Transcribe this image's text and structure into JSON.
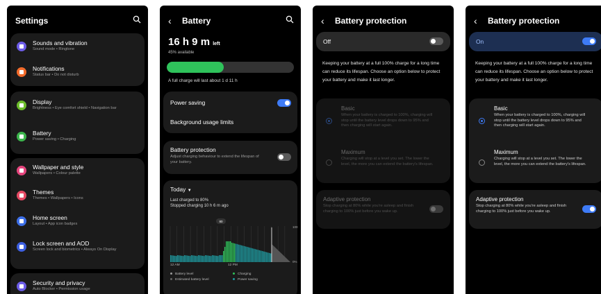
{
  "colors": {
    "accent": "#3e7bf6",
    "battery_green": "#2fc35b",
    "teal": "#1e9aa0",
    "bg": "#000000",
    "card": "#1b1b1b"
  },
  "settings": {
    "title": "Settings",
    "items": [
      {
        "label": "Sounds and vibration",
        "sub": "Sound mode  •  Ringtone",
        "icon": "sound-icon",
        "color": "#6d5ce8"
      },
      {
        "label": "Notifications",
        "sub": "Status bar  •  Do not disturb",
        "icon": "bell-icon",
        "color": "#f26b2b"
      },
      {
        "label": "Display",
        "sub": "Brightness  •  Eye comfort shield  •  Navigation bar",
        "icon": "sun-icon",
        "color": "#6cbc2b"
      },
      {
        "label": "Battery",
        "sub": "Power saving  •  Charging",
        "icon": "battery-icon",
        "color": "#3cb54c"
      },
      {
        "label": "Wallpaper and style",
        "sub": "Wallpapers  •  Colour palette",
        "icon": "image-icon",
        "color": "#e5457d"
      },
      {
        "label": "Themes",
        "sub": "Themes  •  Wallpapers  •  Icons",
        "icon": "palette-icon",
        "color": "#e54a64"
      },
      {
        "label": "Home screen",
        "sub": "Layout  •  App icon badges",
        "icon": "home-icon",
        "color": "#3d6fe8"
      },
      {
        "label": "Lock screen and AOD",
        "sub": "Screen lock and biometrics  •  Always On Display",
        "icon": "lock-icon",
        "color": "#3d5fe0"
      },
      {
        "label": "Security and privacy",
        "sub": "Auto Blocker  •  Permission usage",
        "icon": "shield-icon",
        "color": "#6c5ce7"
      }
    ]
  },
  "battery": {
    "title": "Battery",
    "time_hours": "16 h 9 m",
    "time_suffix": "left",
    "available": "45% available",
    "level": 0.45,
    "full_charge": "A full charge will last about 1 d 11 h",
    "power_saving": "Power saving",
    "power_saving_on": true,
    "background_limits": "Background usage limits",
    "protection_title": "Battery protection",
    "protection_sub": "Adjust charging behaviour to extend the lifespan of your battery.",
    "protection_on": false,
    "today": "Today",
    "last_charged": "Last charged to 80%",
    "stopped": "Stopped charging 10 h 6 m ago",
    "badge": "80",
    "y_top": "100",
    "y_bottom": "0%",
    "x_labels": [
      "12 AM",
      "12 PM"
    ],
    "legend": [
      {
        "label": "Battery level",
        "color": "#9a9a9a"
      },
      {
        "label": "Charging",
        "color": "#2fc35b"
      },
      {
        "label": "Estimated battery level",
        "color": "#666666"
      },
      {
        "label": "Power saving",
        "color": "#1e9aa0"
      }
    ]
  },
  "protection_off": {
    "title": "Battery protection",
    "master_label": "Off",
    "master_on": false,
    "description": "Keeping your battery at a full 100% charge for a long time can reduce its lifespan. Choose an option below to protect your battery and make it last longer.",
    "basic_title": "Basic",
    "basic_sub": "When your battery is charged to 100%, charging will stop until the battery level drops down to 95% and then charging will start again.",
    "maximum_title": "Maximum",
    "maximum_sub": "Charging will stop at a level you set. The lower the level, the more you can extend the battery's lifespan.",
    "adaptive_title": "Adaptive protection",
    "adaptive_sub": "Stop charging at 80% while you're asleep and finish charging to 100% just before you wake up.",
    "adaptive_on": false
  },
  "protection_on": {
    "title": "Battery protection",
    "master_label": "On",
    "master_on": true,
    "description": "Keeping your battery at a full 100% charge for a long time can reduce its lifespan. Choose an option below to protect your battery and make it last longer.",
    "basic_title": "Basic",
    "basic_sub": "When your battery is charged to 100%, charging will stop until the battery level drops down to 95% and then charging will start again.",
    "maximum_title": "Maximum",
    "maximum_sub": "Charging will stop at a level you set. The lower the level, the more you can extend the battery's lifespan.",
    "adaptive_title": "Adaptive protection",
    "adaptive_sub": "Stop charging at 80% while you're asleep and finish charging to 100% just before you wake up.",
    "adaptive_on": true
  }
}
